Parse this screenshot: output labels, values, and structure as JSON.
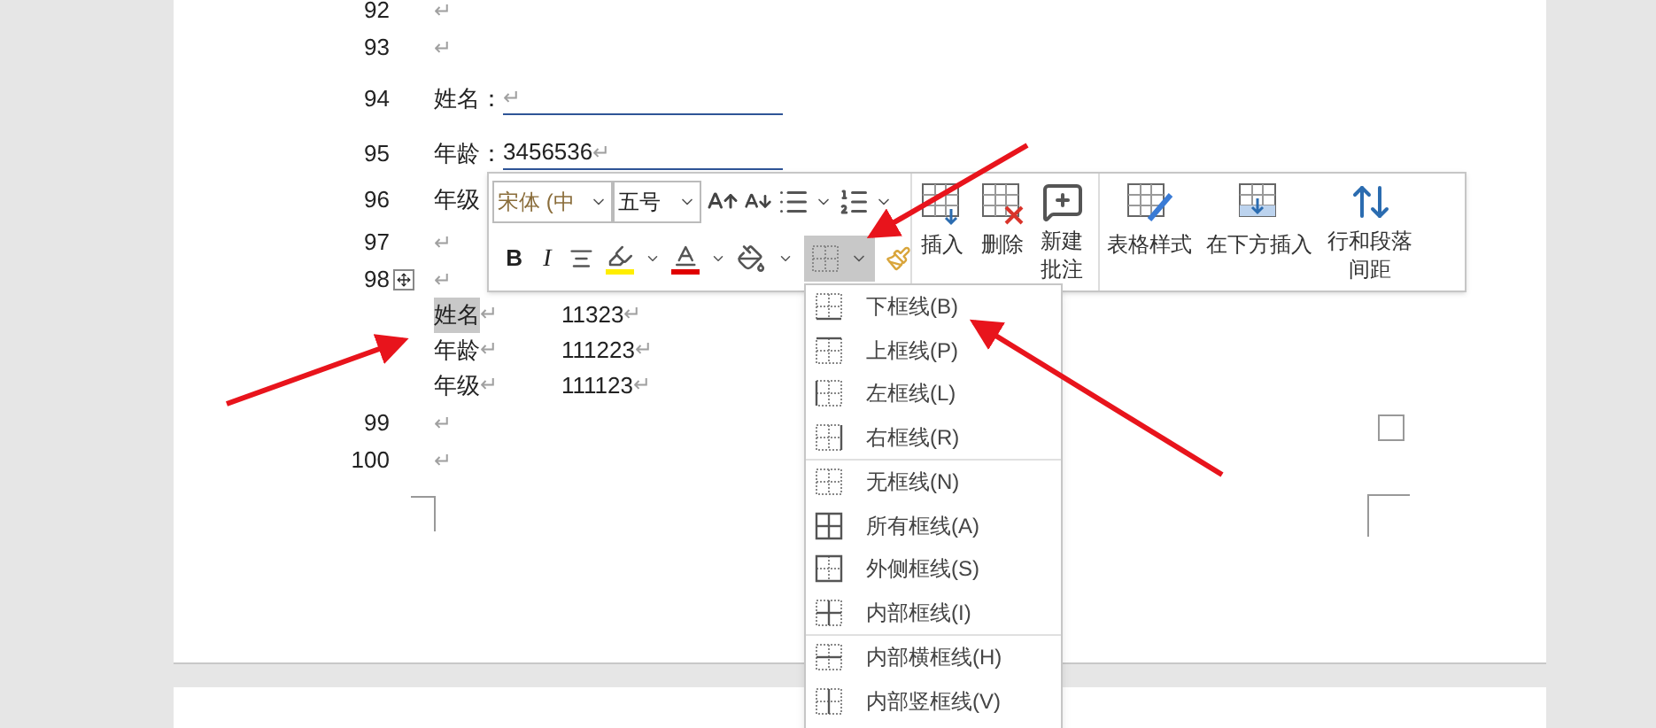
{
  "document": {
    "lines": [
      {
        "number": "92",
        "kind": "blank",
        "mark": "↵"
      },
      {
        "number": "93",
        "kind": "blank",
        "mark": "↵"
      },
      {
        "number": "94",
        "kind": "field",
        "label": "姓名：",
        "mark": "↵"
      },
      {
        "number": "95",
        "kind": "field",
        "label": "年龄：",
        "value": "3456536",
        "mark": "↵"
      },
      {
        "number": "96",
        "kind": "text",
        "label": "年级"
      },
      {
        "number": "97",
        "kind": "blank",
        "mark": "↵"
      },
      {
        "number": "98",
        "kind": "table_anchor",
        "mark": "↵"
      },
      {
        "kind": "table",
        "rows": [
          {
            "cells": [
              {
                "text": "姓名",
                "selected": true,
                "mark": "↵"
              },
              {
                "text": "11323",
                "selected": false,
                "mark": "↵"
              }
            ]
          },
          {
            "cells": [
              {
                "text": "年龄",
                "selected": false,
                "mark": "↵"
              },
              {
                "text": "111223",
                "selected": false,
                "mark": "↵"
              }
            ]
          },
          {
            "cells": [
              {
                "text": "年级",
                "selected": false,
                "mark": "↵"
              },
              {
                "text": "111123",
                "selected": false,
                "mark": "↵"
              }
            ]
          }
        ]
      },
      {
        "number": "99",
        "kind": "blank",
        "mark": "↵"
      },
      {
        "number": "100",
        "kind": "blank",
        "mark": "↵"
      }
    ]
  },
  "mini_toolbar": {
    "font": "宋体 (中",
    "size": "五号",
    "bold": "B",
    "italic": "I",
    "large_buttons": [
      {
        "kind": "insert",
        "label": "插入"
      },
      {
        "kind": "delete",
        "label": "删除"
      },
      {
        "kind": "comment",
        "label": "新建批注"
      },
      {
        "kind": "style",
        "label": "表格样式"
      },
      {
        "kind": "insert_below",
        "label": "在下方插入"
      },
      {
        "kind": "spacing",
        "label": "行和段落间距"
      }
    ],
    "borders_open": true
  },
  "border_menu": {
    "groups": [
      [
        {
          "kind": "bottom",
          "label": "下框线(B)"
        },
        {
          "kind": "top",
          "label": "上框线(P)"
        },
        {
          "kind": "left",
          "label": "左框线(L)"
        },
        {
          "kind": "right",
          "label": "右框线(R)"
        }
      ],
      [
        {
          "kind": "none",
          "label": "无框线(N)"
        },
        {
          "kind": "all",
          "label": "所有框线(A)"
        },
        {
          "kind": "outside",
          "label": "外侧框线(S)"
        },
        {
          "kind": "inside",
          "label": "内部框线(I)"
        }
      ],
      [
        {
          "kind": "inside_h",
          "label": "内部横框线(H)"
        },
        {
          "kind": "inside_v",
          "label": "内部竖框线(V)"
        }
      ]
    ]
  }
}
